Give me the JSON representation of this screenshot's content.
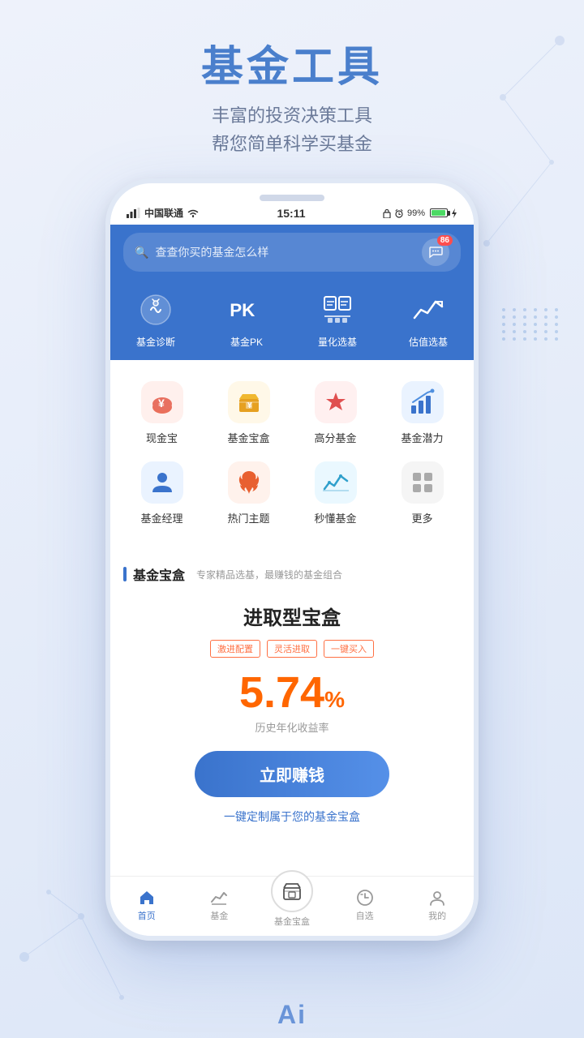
{
  "page": {
    "title": "基金工具",
    "subtitle_line1": "丰富的投资决策工具",
    "subtitle_line2": "帮您简单科学买基金"
  },
  "status_bar": {
    "carrier": "中国联通",
    "time": "15:11",
    "battery": "99%"
  },
  "search": {
    "placeholder": "查查你买的基金怎么样",
    "message_count": "86"
  },
  "top_nav": [
    {
      "id": "fund-diagnosis",
      "label": "基金诊断"
    },
    {
      "id": "fund-pk",
      "label": "基金PK"
    },
    {
      "id": "quantitative",
      "label": "量化选基"
    },
    {
      "id": "valuation",
      "label": "估值选基"
    }
  ],
  "icon_grid_row1": [
    {
      "id": "cash-treasure",
      "label": "现金宝",
      "color": "#fff0ed",
      "icon_color": "#e8614a"
    },
    {
      "id": "fund-box",
      "label": "基金宝盒",
      "color": "#fff8e8",
      "icon_color": "#e6a020"
    },
    {
      "id": "high-score",
      "label": "高分基金",
      "color": "#fff0f0",
      "icon_color": "#e05050"
    },
    {
      "id": "fund-potential",
      "label": "基金潜力",
      "color": "#eaf3ff",
      "icon_color": "#3a73cc"
    }
  ],
  "icon_grid_row2": [
    {
      "id": "fund-manager",
      "label": "基金经理",
      "color": "#eaf3ff",
      "icon_color": "#3a73cc"
    },
    {
      "id": "hot-topic",
      "label": "热门主题",
      "color": "#fff2ec",
      "icon_color": "#e86030"
    },
    {
      "id": "understand-fund",
      "label": "秒懂基金",
      "color": "#eaf8ff",
      "icon_color": "#30a0cc"
    },
    {
      "id": "more",
      "label": "更多",
      "color": "#f5f5f5",
      "icon_color": "#888"
    }
  ],
  "section": {
    "title": "基金宝盒",
    "subtitle": "专家精品选基，最赚钱的基金组合"
  },
  "fund_card": {
    "title": "进取型宝盒",
    "tags": [
      "激进配置",
      "灵活进取",
      "一键买入"
    ],
    "rate": "5.74",
    "rate_unit": "%",
    "rate_label": "历史年化收益率",
    "cta_button": "立即赚钱",
    "custom_link": "一键定制属于您的基金宝盒"
  },
  "bottom_nav": [
    {
      "id": "home",
      "label": "首页",
      "active": true
    },
    {
      "id": "fund",
      "label": "基金",
      "active": false
    },
    {
      "id": "fund-box-center",
      "label": "基金宝盒",
      "active": false,
      "center": true
    },
    {
      "id": "watchlist",
      "label": "自选",
      "active": false
    },
    {
      "id": "mine",
      "label": "我的",
      "active": false
    }
  ]
}
